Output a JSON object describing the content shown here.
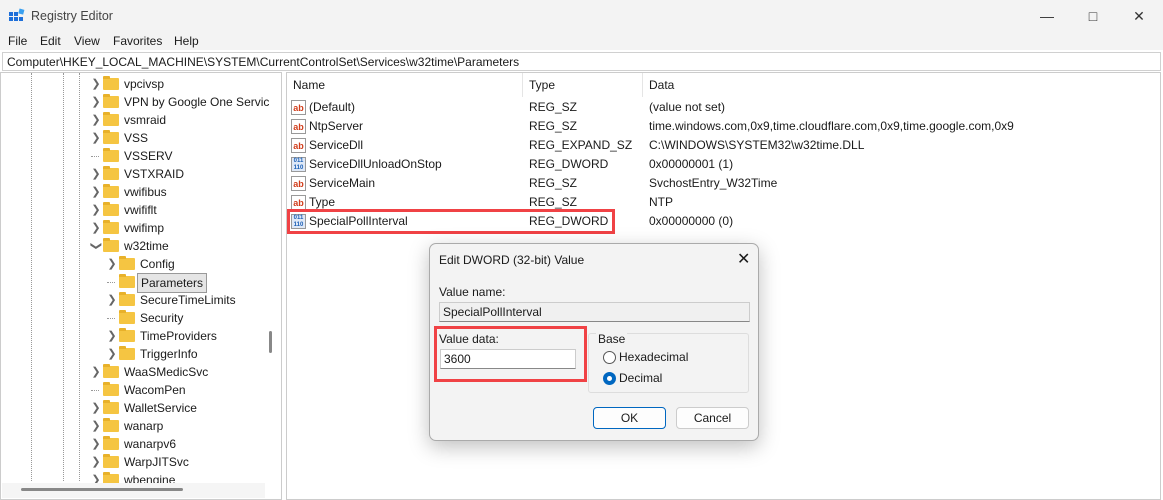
{
  "window": {
    "title": "Registry Editor",
    "minimize_icon": "minimize-icon",
    "maximize_icon": "maximize-icon",
    "close_icon": "close-icon"
  },
  "menu": [
    "File",
    "Edit",
    "View",
    "Favorites",
    "Help"
  ],
  "address": "Computer\\HKEY_LOCAL_MACHINE\\SYSTEM\\CurrentControlSet\\Services\\w32time\\Parameters",
  "tree": [
    {
      "label": "vpcivsp",
      "level": 1,
      "expander": "collapsed"
    },
    {
      "label": "VPN by Google One Servic",
      "level": 1,
      "expander": "collapsed"
    },
    {
      "label": "vsmraid",
      "level": 1,
      "expander": "collapsed"
    },
    {
      "label": "VSS",
      "level": 1,
      "expander": "collapsed"
    },
    {
      "label": "VSSERV",
      "level": 1,
      "expander": "none"
    },
    {
      "label": "VSTXRAID",
      "level": 1,
      "expander": "collapsed"
    },
    {
      "label": "vwifibus",
      "level": 1,
      "expander": "collapsed"
    },
    {
      "label": "vwififlt",
      "level": 1,
      "expander": "collapsed"
    },
    {
      "label": "vwifimp",
      "level": 1,
      "expander": "collapsed"
    },
    {
      "label": "w32time",
      "level": 1,
      "expander": "expanded"
    },
    {
      "label": "Config",
      "level": 2,
      "expander": "collapsed"
    },
    {
      "label": "Parameters",
      "level": 2,
      "expander": "none",
      "selected": true
    },
    {
      "label": "SecureTimeLimits",
      "level": 2,
      "expander": "collapsed"
    },
    {
      "label": "Security",
      "level": 2,
      "expander": "none"
    },
    {
      "label": "TimeProviders",
      "level": 2,
      "expander": "collapsed"
    },
    {
      "label": "TriggerInfo",
      "level": 2,
      "expander": "collapsed"
    },
    {
      "label": "WaaSMedicSvc",
      "level": 1,
      "expander": "collapsed"
    },
    {
      "label": "WacomPen",
      "level": 1,
      "expander": "none"
    },
    {
      "label": "WalletService",
      "level": 1,
      "expander": "collapsed"
    },
    {
      "label": "wanarp",
      "level": 1,
      "expander": "collapsed"
    },
    {
      "label": "wanarpv6",
      "level": 1,
      "expander": "collapsed"
    },
    {
      "label": "WarpJITSvc",
      "level": 1,
      "expander": "collapsed"
    },
    {
      "label": "wbengine",
      "level": 1,
      "expander": "collapsed"
    }
  ],
  "list": {
    "columns": [
      "Name",
      "Type",
      "Data"
    ],
    "rows": [
      {
        "name": "(Default)",
        "type": "REG_SZ",
        "data": "(value not set)",
        "icon": "string"
      },
      {
        "name": "NtpServer",
        "type": "REG_SZ",
        "data": "time.windows.com,0x9,time.cloudflare.com,0x9,time.google.com,0x9",
        "icon": "string"
      },
      {
        "name": "ServiceDll",
        "type": "REG_EXPAND_SZ",
        "data": "C:\\WINDOWS\\SYSTEM32\\w32time.DLL",
        "icon": "string"
      },
      {
        "name": "ServiceDllUnloadOnStop",
        "type": "REG_DWORD",
        "data": "0x00000001 (1)",
        "icon": "binary"
      },
      {
        "name": "ServiceMain",
        "type": "REG_SZ",
        "data": "SvchostEntry_W32Time",
        "icon": "string"
      },
      {
        "name": "Type",
        "type": "REG_SZ",
        "data": "NTP",
        "icon": "string"
      },
      {
        "name": "SpecialPollInterval",
        "type": "REG_DWORD",
        "data": "0x00000000 (0)",
        "icon": "binary",
        "highlighted": true
      }
    ]
  },
  "dialog": {
    "title": "Edit DWORD (32-bit) Value",
    "value_name_label": "Value name:",
    "value_name": "SpecialPollInterval",
    "value_data_label": "Value data:",
    "value_data": "3600",
    "base_label": "Base",
    "hex_label": "Hexadecimal",
    "dec_label": "Decimal",
    "selected_base": "Decimal",
    "ok": "OK",
    "cancel": "Cancel"
  },
  "colors": {
    "highlight": "#f04245",
    "accent": "#0067c0",
    "folder": "#f5c542"
  }
}
